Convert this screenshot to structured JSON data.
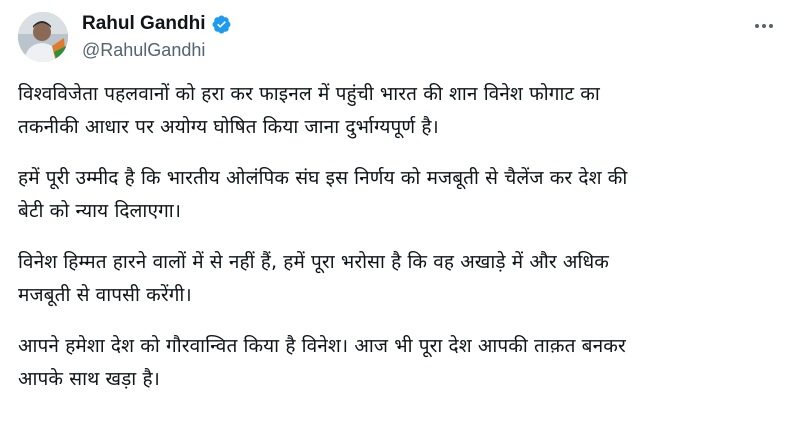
{
  "author": {
    "display_name": "Rahul Gandhi",
    "handle": "@RahulGandhi",
    "verified": true,
    "verified_color": "#1d9bf0"
  },
  "icons": {
    "verified": "verified-badge-icon",
    "more": "more-options-icon"
  },
  "tweet": {
    "paragraphs": [
      {
        "lines": [
          "विश्वविजेता पहलवानों को हरा कर फाइनल में पहुंची भारत की शान विनेश फोगाट का",
          "तकनीकी आधार पर अयोग्य घोषित किया जाना दुर्भाग्यपूर्ण है।"
        ]
      },
      {
        "lines": [
          "हमें पूरी उम्मीद है कि भारतीय ओलंपिक संघ इस निर्णय को मजबूती से चैलेंज कर देश की",
          "बेटी को न्याय दिलाएगा।"
        ]
      },
      {
        "lines": [
          "विनेश हिम्मत हारने वालों में से नहीं हैं, हमें पूरा भरोसा है कि वह अखाड़े में और अधिक",
          "मजबूती से वापसी करेंगी।"
        ]
      },
      {
        "lines": [
          "आपने हमेशा देश को गौरवान्वित किया है विनेश। आज भी पूरा देश आपकी ताक़त बनकर",
          "आपके साथ खड़ा है।"
        ]
      }
    ]
  }
}
